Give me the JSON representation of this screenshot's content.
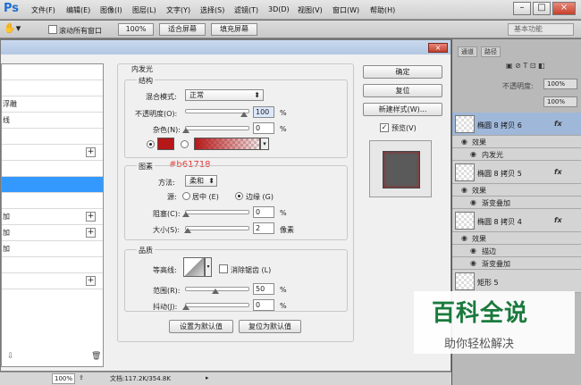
{
  "app": {
    "logo": "Ps"
  },
  "menu": [
    "文件(F)",
    "编辑(E)",
    "图像(I)",
    "图层(L)",
    "文字(Y)",
    "选择(S)",
    "滤镜(T)",
    "3D(D)",
    "视图(V)",
    "窗口(W)",
    "帮助(H)"
  ],
  "window_controls": {
    "minimize": "–",
    "restore": "□",
    "close": "×"
  },
  "options_bar": {
    "scroll_all_windows": "滚动所有窗口",
    "zoom": "100%",
    "fit_screen": "适合屏幕",
    "fill_screen": "填充屏幕",
    "workspace": "基本功能"
  },
  "dialog": {
    "close": "×",
    "section_title": "内发光",
    "structure": {
      "title": "结构",
      "blend_mode_label": "混合模式:",
      "blend_mode_value": "正常",
      "opacity_label": "不透明度(O):",
      "opacity_value": "100",
      "noise_label": "杂色(N):",
      "noise_value": "0",
      "pct": "%"
    },
    "color_annotation": "#b61718",
    "color_hex": "#b61718",
    "elements": {
      "title": "图素",
      "method_label": "方法:",
      "method_value": "柔和",
      "source_label": "源:",
      "source_center": "居中 (E)",
      "source_edge": "边缘 (G)",
      "choke_label": "阻塞(C):",
      "choke_value": "0",
      "size_label": "大小(S):",
      "size_value": "2",
      "pct": "%",
      "px": "像素"
    },
    "quality": {
      "title": "品质",
      "contour_label": "等高线:",
      "anti_alias": "消除锯齿 (L)",
      "range_label": "范围(R):",
      "range_value": "50",
      "jitter_label": "抖动(J):",
      "jitter_value": "0",
      "pct": "%"
    },
    "set_default": "设置为默认值",
    "reset_default": "复位为默认值",
    "ok": "确定",
    "reset": "复位",
    "new_style": "新建样式(W)...",
    "preview_label": "预览(V)",
    "style_list": [
      "",
      "",
      "浮雕",
      "线",
      "",
      "",
      "",
      "",
      "加",
      "加",
      "加",
      "",
      ""
    ],
    "style_add": "+"
  },
  "status": {
    "zoom": "100%",
    "doc": "文档:117.2K/354.8K"
  },
  "layers_panel": {
    "tabs": [
      "通道",
      "路径"
    ],
    "opacity_label": "不透明度:",
    "opacity_value": "100%",
    "fill_value": "100%",
    "layers": [
      {
        "name": "椭圆 8 拷贝 6",
        "fx": "fx",
        "effects_label": "效果",
        "effects": [
          "内发光"
        ]
      },
      {
        "name": "椭圆 8 拷贝 5",
        "fx": "fx",
        "effects_label": "效果",
        "effects": [
          "渐变叠加"
        ]
      },
      {
        "name": "椭圆 8 拷贝 4",
        "fx": "fx",
        "effects_label": "效果",
        "effects": [
          "描边",
          "渐变叠加"
        ]
      },
      {
        "name": "矩形 5",
        "fx": "",
        "effects_label": "",
        "effects": []
      }
    ]
  },
  "watermark": {
    "title": "百科全说",
    "subtitle": "助你轻松解决"
  }
}
